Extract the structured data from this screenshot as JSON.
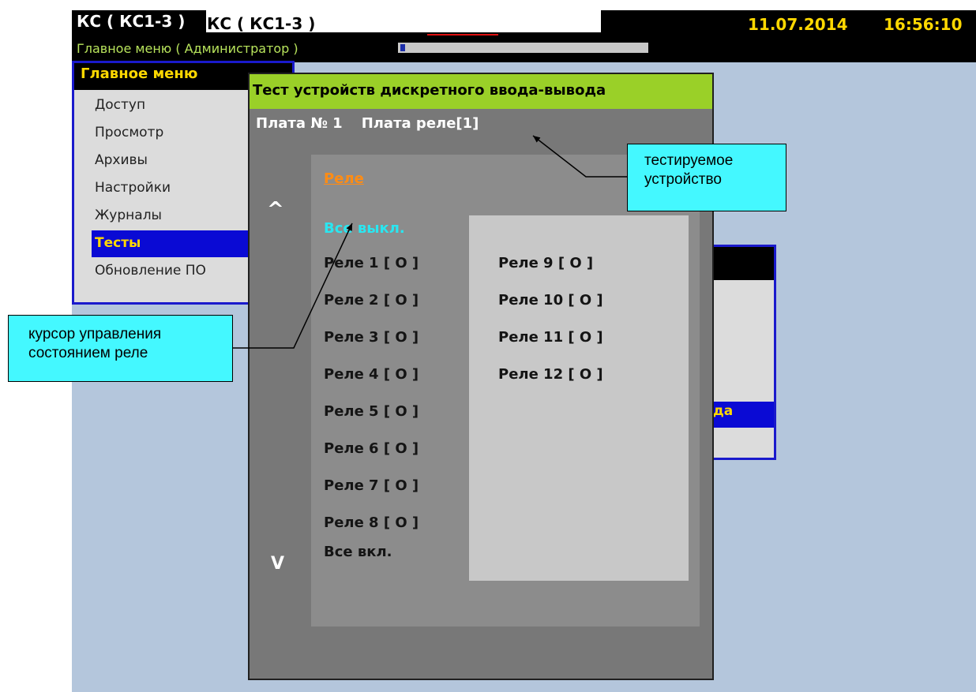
{
  "header": {
    "app_title": "КС ( КС1-3 )",
    "app_title_duplicate": "КС ( КС1-3 )",
    "subtitle": "Главное меню ( Администратор )",
    "date": "11.07.2014",
    "time": "16:56:10",
    "progress_fraction": 0.02
  },
  "main_menu": {
    "title": "Главное меню",
    "items": [
      {
        "label": "Доступ"
      },
      {
        "label": "Просмотр"
      },
      {
        "label": "Архивы"
      },
      {
        "label": "Настройки"
      },
      {
        "label": "Журналы"
      },
      {
        "label": "Тесты",
        "selected": true
      },
      {
        "label": "Обновление ПО"
      }
    ]
  },
  "background_window": {
    "selected_fragment": "да"
  },
  "test_dialog": {
    "title": "Тест устройств дискретного ввода-вывода",
    "board_label": "Плата № 1",
    "board_device": "Плата реле[1]",
    "scroll_up": "^",
    "scroll_down": "V",
    "section_header": "Реле",
    "all_off": "Все выкл.",
    "all_on": "Все вкл.",
    "relays_col1": [
      "Реле 1 [ О ]",
      "Реле 2 [ О ]",
      "Реле 3 [ О ]",
      "Реле 4 [ О ]",
      "Реле 5 [ О ]",
      "Реле 6 [ О ]",
      "Реле 7 [ О ]",
      "Реле 8 [ О ]"
    ],
    "relays_col2": [
      "Реле 9 [ О ]",
      "Реле 10 [ О ]",
      "Реле 11 [ О ]",
      "Реле 12 [ О ]"
    ]
  },
  "annotations": {
    "device_callout": [
      "тестируемое",
      "устройство"
    ],
    "cursor_callout": [
      "курсор управления",
      "состоянием реле"
    ]
  },
  "colors": {
    "screen_bg": "#b4c6dc",
    "title_green": "#9ad028",
    "accent_yellow": "#ffd800",
    "cursor_cyan": "#2ae6f0",
    "section_orange": "#ff8c14",
    "selection_blue": "#0a0ad4",
    "callout_cyan": "#44f8ff"
  }
}
